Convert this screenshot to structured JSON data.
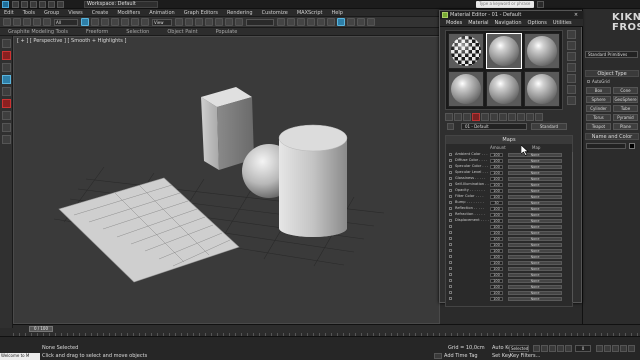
{
  "titlebar": {
    "workspace": "Workspace: Default",
    "search_placeholder": "Type a keyword or phrase"
  },
  "menubar": [
    "Edit",
    "Tools",
    "Group",
    "Views",
    "Create",
    "Modifiers",
    "Animation",
    "Graph Editors",
    "Rendering",
    "Customize",
    "MAXScript",
    "Help"
  ],
  "toolbar": {
    "filter": "All",
    "refcoord": "View",
    "selection_set": ""
  },
  "ribbon": [
    "Graphite Modeling Tools",
    "Freeform",
    "Selection",
    "Object Paint",
    "Populate"
  ],
  "viewport": {
    "label": "[ + ] [ Perspective ] [ Smooth + Highlights ]"
  },
  "timeline": {
    "slider": "0 / 100"
  },
  "status": {
    "none_selected": "None Selected",
    "prompt": "Click and drag to select and move objects",
    "maxscript": "Welcome to M",
    "grid": "Grid = 10,0cm",
    "auto_key": "Auto Key",
    "selected": "Selected",
    "set_key": "Set Key",
    "key_filters": "Key Filters...",
    "add_time_tag": "Add Time Tag",
    "frame": "0"
  },
  "command_panel": {
    "dropdown": "Standard Primitives",
    "object_type": "Object Type",
    "autogrid": "AutoGrid",
    "buttons": [
      "Box",
      "Cone",
      "Sphere",
      "GeoSphere",
      "Cylinder",
      "Tube",
      "Torus",
      "Pyramid",
      "Teapot",
      "Plane"
    ],
    "name_and_color": "Name and Color"
  },
  "logo": {
    "line1": "KIKNIK",
    "line2": "FROST"
  },
  "material_editor": {
    "title": "Material Editor - 01 - Default",
    "menu": [
      "Modes",
      "Material",
      "Navigation",
      "Options",
      "Utilities"
    ],
    "material_name": "01 - Default",
    "material_type": "Standard",
    "maps_header": "Maps",
    "col_amount": "Amount",
    "col_map": "Map",
    "rows": [
      {
        "label": "Ambient Color . . .",
        "amount": "100",
        "map": "None"
      },
      {
        "label": "Diffuse Color . . . .",
        "amount": "100",
        "map": "None"
      },
      {
        "label": "Specular Color . . .",
        "amount": "100",
        "map": "None"
      },
      {
        "label": "Specular Level . . .",
        "amount": "100",
        "map": "None"
      },
      {
        "label": "Glossiness . . . . .",
        "amount": "100",
        "map": "None"
      },
      {
        "label": "Self-Illumination . .",
        "amount": "100",
        "map": "None"
      },
      {
        "label": "Opacity . . . . . . .",
        "amount": "100",
        "map": "None"
      },
      {
        "label": "Filter Color . . . .",
        "amount": "100",
        "map": "None"
      },
      {
        "label": "Bump . . . . . . . .",
        "amount": "30",
        "map": "None"
      },
      {
        "label": "Reflection . . . . .",
        "amount": "100",
        "map": "None"
      },
      {
        "label": "Refraction . . . . .",
        "amount": "100",
        "map": "None"
      },
      {
        "label": "Displacement . . . .",
        "amount": "100",
        "map": "None"
      },
      {
        "label": "",
        "amount": "100",
        "map": "None"
      },
      {
        "label": "",
        "amount": "100",
        "map": "None"
      },
      {
        "label": "",
        "amount": "100",
        "map": "None"
      },
      {
        "label": "",
        "amount": "100",
        "map": "None"
      },
      {
        "label": "",
        "amount": "100",
        "map": "None"
      },
      {
        "label": "",
        "amount": "100",
        "map": "None"
      },
      {
        "label": "",
        "amount": "100",
        "map": "None"
      },
      {
        "label": "",
        "amount": "100",
        "map": "None"
      },
      {
        "label": "",
        "amount": "100",
        "map": "None"
      },
      {
        "label": "",
        "amount": "100",
        "map": "None"
      },
      {
        "label": "",
        "amount": "100",
        "map": "None"
      },
      {
        "label": "",
        "amount": "100",
        "map": "None"
      },
      {
        "label": "",
        "amount": "100",
        "map": "None"
      }
    ]
  },
  "colors": {
    "accent": "#2e7fa8",
    "background": "#2b2b2b"
  }
}
